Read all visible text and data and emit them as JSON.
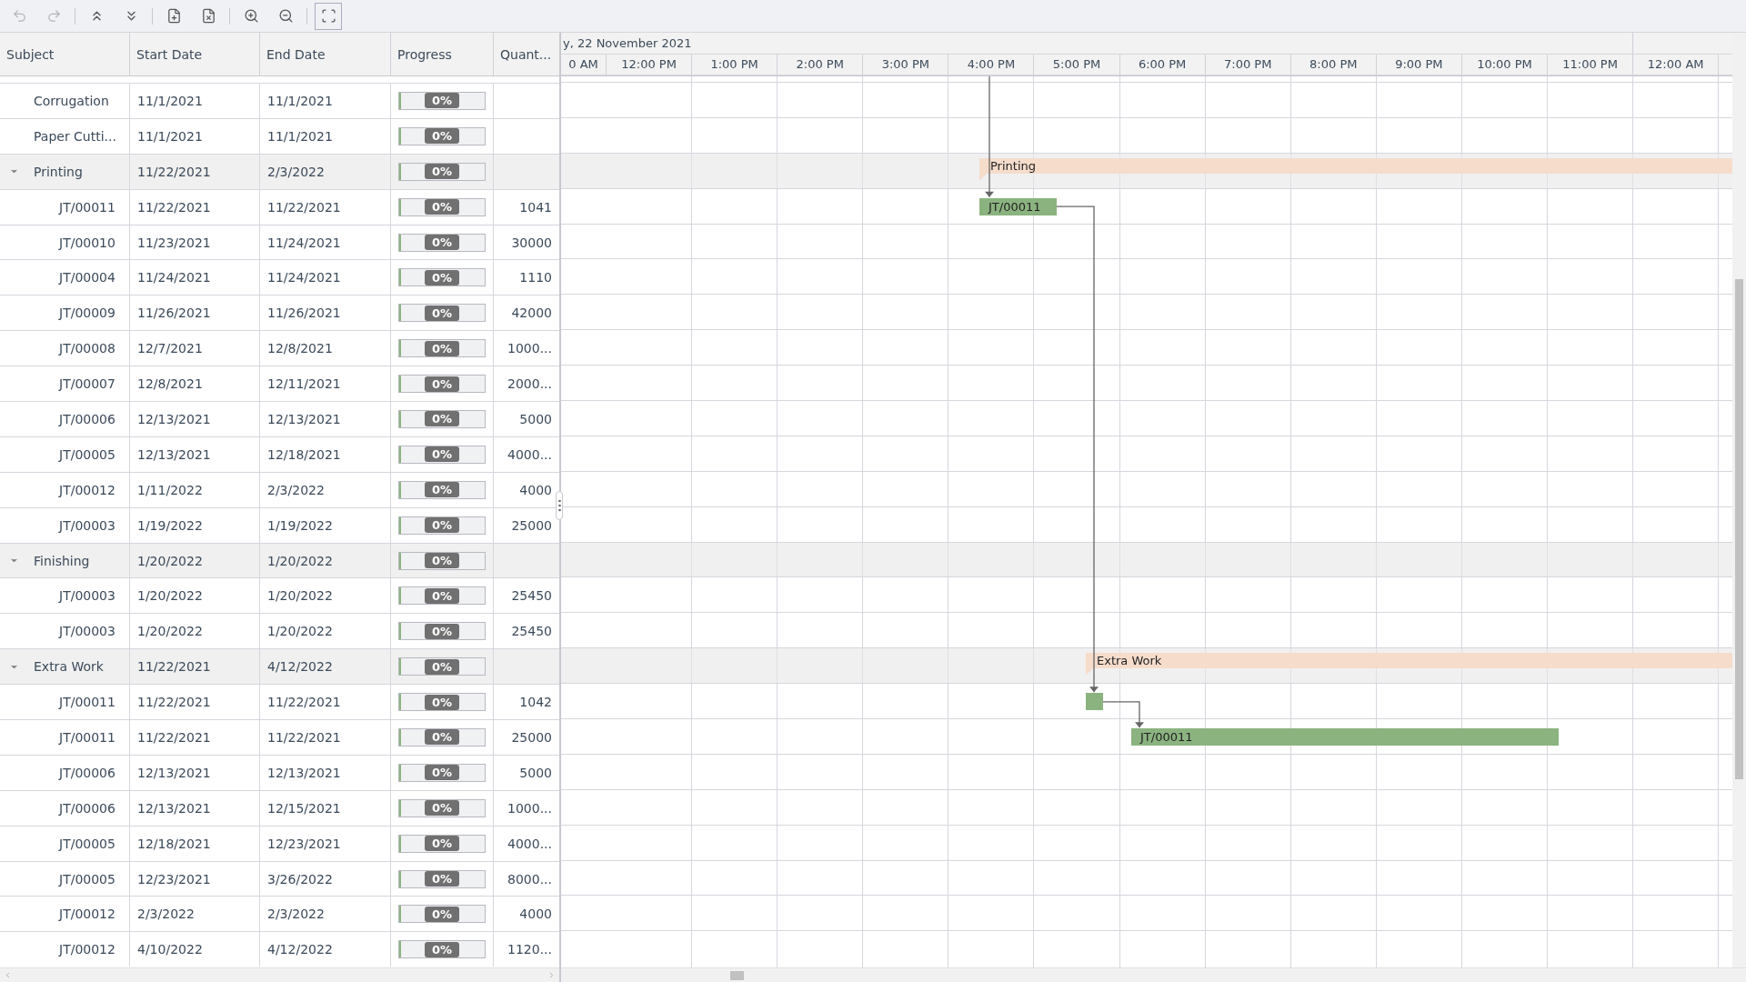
{
  "toolbar": [
    {
      "kind": "undo",
      "disabled": true,
      "selected": false
    },
    {
      "kind": "redo",
      "disabled": true,
      "selected": false
    },
    {
      "kind": "collapse-all",
      "disabled": false,
      "selected": false
    },
    {
      "kind": "expand-all",
      "disabled": false,
      "selected": false
    },
    {
      "kind": "add",
      "disabled": false,
      "selected": false
    },
    {
      "kind": "delete",
      "disabled": false,
      "selected": false
    },
    {
      "kind": "zoom-in",
      "disabled": false,
      "selected": false
    },
    {
      "kind": "zoom-out",
      "disabled": false,
      "selected": false
    },
    {
      "kind": "fit",
      "disabled": false,
      "selected": true
    }
  ],
  "table": {
    "columns": [
      "Subject",
      "Start Date",
      "End Date",
      "Progress",
      "Quant..."
    ],
    "rows": [
      {
        "subject": "Corrugation",
        "start": "11/1/2021",
        "end": "11/1/2021",
        "progress": "0%",
        "level": 0
      },
      {
        "subject": "Paper Cutti...",
        "start": "11/1/2021",
        "end": "11/1/2021",
        "progress": "0%",
        "level": 0
      },
      {
        "subject": "Printing",
        "start": "11/22/2021",
        "end": "2/3/2022",
        "progress": "0%",
        "level": 0,
        "expanded": true,
        "children": [
          {
            "subject": "JT/00011",
            "start": "11/22/2021",
            "end": "11/22/2021",
            "progress": "0%",
            "level": 0,
            "quantity": "1041"
          },
          {
            "subject": "JT/00010",
            "start": "11/23/2021",
            "end": "11/24/2021",
            "progress": "0%",
            "level": 0,
            "quantity": "30000"
          },
          {
            "subject": "JT/00004",
            "start": "11/24/2021",
            "end": "11/24/2021",
            "progress": "0%",
            "level": 0,
            "quantity": "1110"
          },
          {
            "subject": "JT/00009",
            "start": "11/26/2021",
            "end": "11/26/2021",
            "progress": "0%",
            "level": 0,
            "quantity": "42000"
          },
          {
            "subject": "JT/00008",
            "start": "12/7/2021",
            "end": "12/8/2021",
            "progress": "0%",
            "level": 0,
            "quantity": "1000..."
          },
          {
            "subject": "JT/00007",
            "start": "12/8/2021",
            "end": "12/11/2021",
            "progress": "0%",
            "level": 0,
            "quantity": "2000..."
          },
          {
            "subject": "JT/00006",
            "start": "12/13/2021",
            "end": "12/13/2021",
            "progress": "0%",
            "level": 0,
            "quantity": "5000"
          },
          {
            "subject": "JT/00005",
            "start": "12/13/2021",
            "end": "12/18/2021",
            "progress": "0%",
            "level": 0,
            "quantity": "4000..."
          },
          {
            "subject": "JT/00012",
            "start": "1/11/2022",
            "end": "2/3/2022",
            "progress": "0%",
            "level": 0,
            "quantity": "4000"
          },
          {
            "subject": "JT/00003",
            "start": "1/19/2022",
            "end": "1/19/2022",
            "progress": "0%",
            "level": 0,
            "quantity": "25000"
          }
        ]
      },
      {
        "subject": "Finishing",
        "start": "1/20/2022",
        "end": "1/20/2022",
        "progress": "0%",
        "level": 0,
        "expanded": true,
        "children": [
          {
            "subject": "JT/00003",
            "start": "1/20/2022",
            "end": "1/20/2022",
            "progress": "0%",
            "level": 0,
            "quantity": "25450"
          },
          {
            "subject": "JT/00003",
            "start": "1/20/2022",
            "end": "1/20/2022",
            "progress": "0%",
            "level": 0,
            "quantity": "25450"
          }
        ]
      },
      {
        "subject": "Extra Work",
        "start": "11/22/2021",
        "end": "4/12/2022",
        "progress": "0%",
        "level": 0,
        "expanded": true,
        "children": [
          {
            "subject": "JT/00011",
            "start": "11/22/2021",
            "end": "11/22/2021",
            "progress": "0%",
            "level": 0,
            "quantity": "1042"
          },
          {
            "subject": "JT/00011",
            "start": "11/22/2021",
            "end": "11/22/2021",
            "progress": "0%",
            "level": 0,
            "quantity": "25000"
          },
          {
            "subject": "JT/00006",
            "start": "12/13/2021",
            "end": "12/13/2021",
            "progress": "0%",
            "level": 0,
            "quantity": "5000"
          },
          {
            "subject": "JT/00006",
            "start": "12/13/2021",
            "end": "12/15/2021",
            "progress": "0%",
            "level": 0,
            "quantity": "1000..."
          },
          {
            "subject": "JT/00005",
            "start": "12/18/2021",
            "end": "12/23/2021",
            "progress": "0%",
            "level": 0,
            "quantity": "4000..."
          },
          {
            "subject": "JT/00005",
            "start": "12/23/2021",
            "end": "3/26/2022",
            "progress": "0%",
            "level": 0,
            "quantity": "8000..."
          },
          {
            "subject": "JT/00012",
            "start": "2/3/2022",
            "end": "2/3/2022",
            "progress": "0%",
            "level": 0,
            "quantity": "4000"
          },
          {
            "subject": "JT/00012",
            "start": "4/10/2022",
            "end": "4/12/2022",
            "progress": "0%",
            "level": 0,
            "quantity": "1120..."
          }
        ]
      }
    ]
  },
  "timeline": {
    "day": "y, 22 November 2021",
    "hours": [
      "0 AM",
      "12:00 PM",
      "1:00 PM",
      "2:00 PM",
      "3:00 PM",
      "4:00 PM",
      "5:00 PM",
      "6:00 PM",
      "7:00 PM",
      "8:00 PM",
      "9:00 PM",
      "10:00 PM",
      "11:00 PM",
      "12:00 AM"
    ]
  },
  "gantt": {
    "bars": [
      {
        "kind": "summary",
        "label": "Printing"
      },
      {
        "kind": "task",
        "label": "JT/00011"
      },
      {
        "kind": "summary",
        "label": "Extra Work"
      },
      {
        "kind": "task"
      },
      {
        "kind": "task",
        "label": "JT/00011"
      }
    ]
  }
}
